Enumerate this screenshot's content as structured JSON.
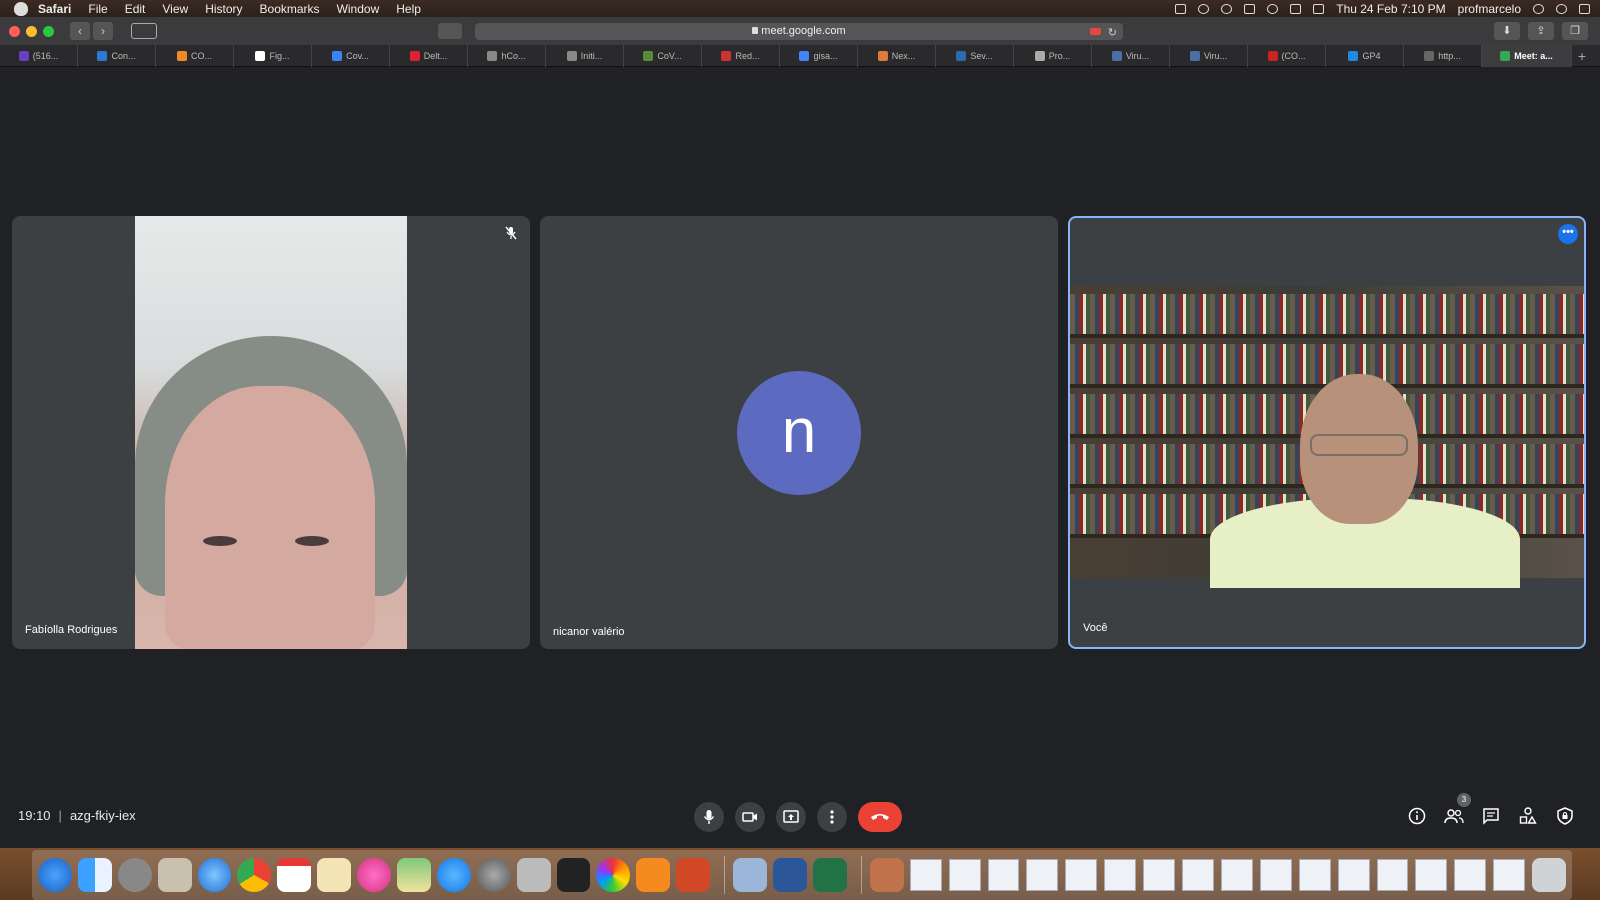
{
  "menubar": {
    "app": "Safari",
    "items": [
      "File",
      "Edit",
      "View",
      "History",
      "Bookmarks",
      "Window",
      "Help"
    ],
    "datetime": "Thu 24 Feb  7:10 PM",
    "user": "profmarcelo"
  },
  "browser": {
    "url": "meet.google.com",
    "tabs": [
      {
        "label": "(516...",
        "color": "#6a3fc0"
      },
      {
        "label": "Con...",
        "color": "#2d7ad6"
      },
      {
        "label": "CO...",
        "color": "#f08a24"
      },
      {
        "label": "Fig...",
        "color": "#ffffff"
      },
      {
        "label": "Cov...",
        "color": "#3b82f6"
      },
      {
        "label": "Delt...",
        "color": "#d23"
      },
      {
        "label": "hCo...",
        "color": "#888"
      },
      {
        "label": "Initi...",
        "color": "#888"
      },
      {
        "label": "CoV...",
        "color": "#5a8a3a"
      },
      {
        "label": "Red...",
        "color": "#c33"
      },
      {
        "label": "gisa...",
        "color": "#4285f4"
      },
      {
        "label": "Nex...",
        "color": "#e07b39"
      },
      {
        "label": "Sev...",
        "color": "#2b6cb0"
      },
      {
        "label": "Pro...",
        "color": "#aaa"
      },
      {
        "label": "Viru...",
        "color": "#4a6fa5"
      },
      {
        "label": "Viru...",
        "color": "#4a6fa5"
      },
      {
        "label": "(CO...",
        "color": "#c22"
      },
      {
        "label": "GP4",
        "color": "#1e88e5"
      },
      {
        "label": "http...",
        "color": "#666"
      },
      {
        "label": "Meet: a...",
        "color": "#34a853"
      }
    ]
  },
  "meet": {
    "participants": [
      {
        "name": "Fabíolla Rodrigues"
      },
      {
        "name": "nicanor valério",
        "initial": "n"
      },
      {
        "name": "Você"
      }
    ],
    "time": "19:10",
    "meeting_code": "azg-fkiy-iex",
    "people_count": "3"
  },
  "colors": {
    "accent": "#8ab4f8",
    "end_call": "#ea4335",
    "avatar": "#5c6bc0"
  }
}
